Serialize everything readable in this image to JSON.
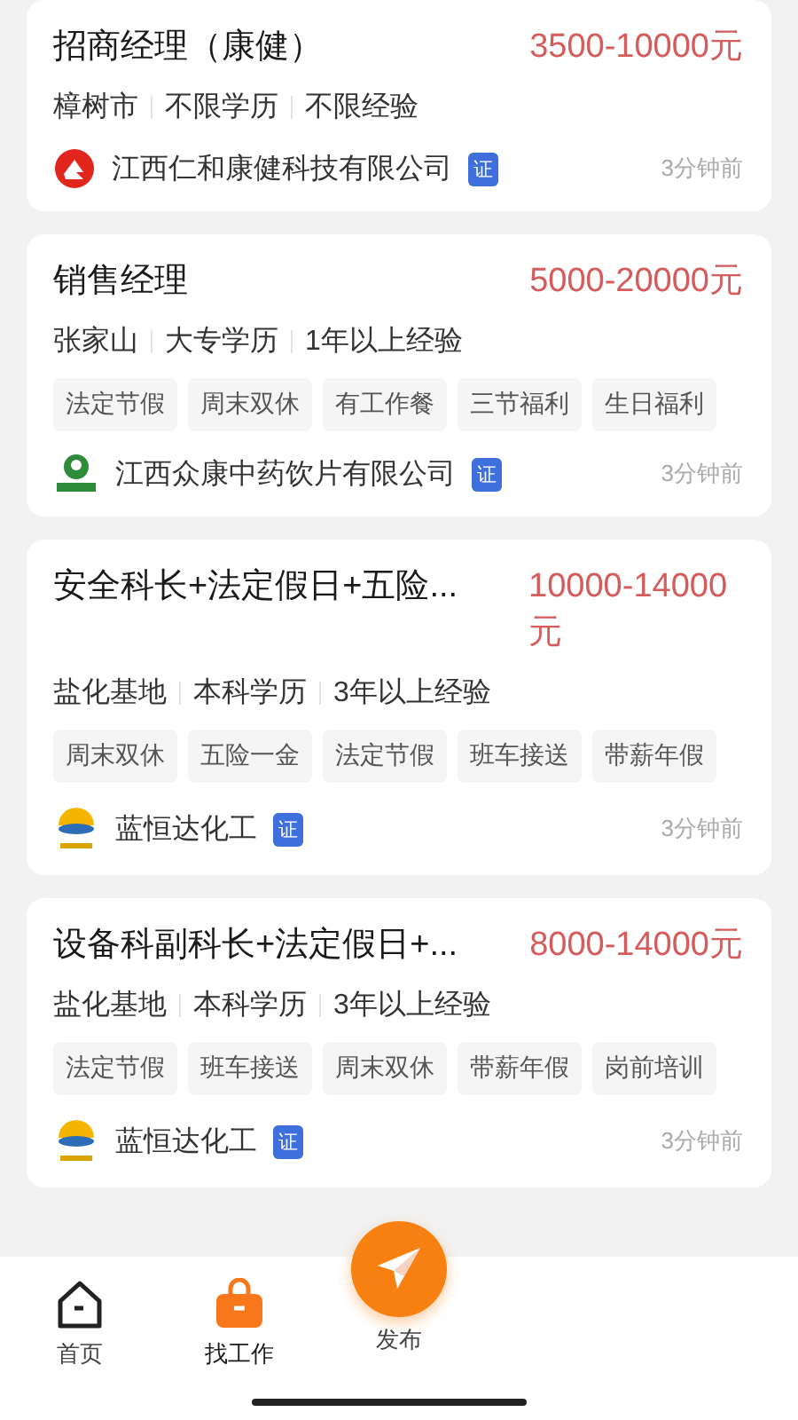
{
  "jobs": [
    {
      "title": "招商经理（康健）",
      "salary": "3500-10000元",
      "meta": [
        "樟树市",
        "不限学历",
        "不限经验"
      ],
      "company": "江西仁和康健科技有限公司",
      "kind": "red",
      "verified_badge": "证",
      "time": "3分钟前"
    },
    {
      "title": "销售经理",
      "salary": "5000-20000元",
      "meta": [
        "张家山",
        "大专学历",
        "1年以上经验"
      ],
      "tags": [
        "法定节假",
        "周末双休",
        "有工作餐",
        "三节福利",
        "生日福利"
      ],
      "company": "江西众康中药饮片有限公司",
      "kind": "green",
      "verified_badge": "证",
      "time": "3分钟前"
    },
    {
      "title": "安全科长+法定假日+五险...",
      "salary": "10000-14000元",
      "meta": [
        "盐化基地",
        "本科学历",
        "3年以上经验"
      ],
      "tags": [
        "周末双休",
        "五险一金",
        "法定节假",
        "班车接送",
        "带薪年假"
      ],
      "company": "蓝恒达化工",
      "kind": "sun",
      "verified_badge": "证",
      "time": "3分钟前"
    },
    {
      "title": "设备科副科长+法定假日+...",
      "salary": "8000-14000元",
      "meta": [
        "盐化基地",
        "本科学历",
        "3年以上经验"
      ],
      "tags": [
        "法定节假",
        "班车接送",
        "周末双休",
        "带薪年假",
        "岗前培训"
      ],
      "company": "蓝恒达化工",
      "kind": "sun",
      "verified_badge": "证",
      "time": "3分钟前"
    }
  ],
  "nav": [
    {
      "kind": "home",
      "label": "首页",
      "selected": false
    },
    {
      "kind": "jobs",
      "label": "找工作",
      "selected": true
    },
    {
      "kind": "publish",
      "label": "发布",
      "selected": false
    }
  ]
}
